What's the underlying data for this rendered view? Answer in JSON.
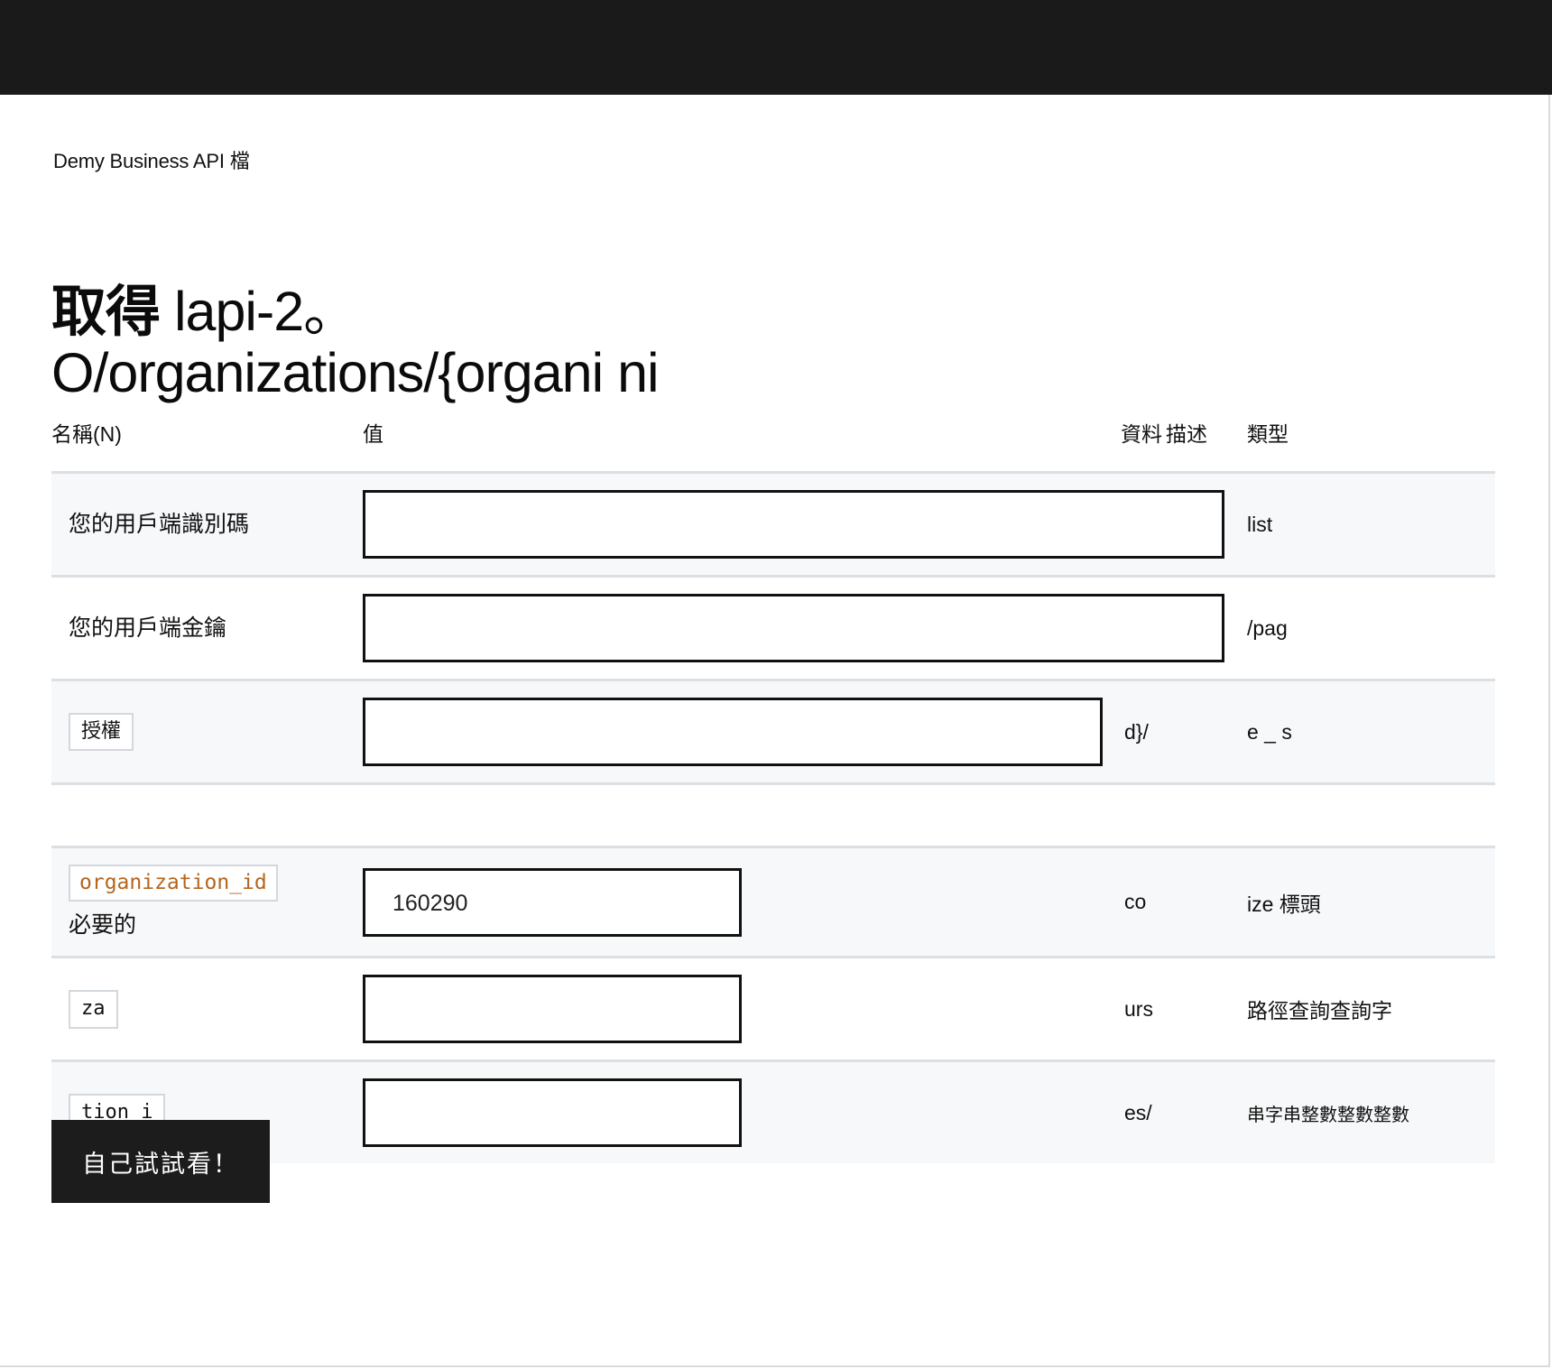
{
  "breadcrumb": "Demy Business API 檔",
  "title": {
    "verb": "取得",
    "path": "lapi-2。O/organizations/{organi ni"
  },
  "table": {
    "headers": {
      "name": "名稱(N)",
      "value": "值",
      "description": "描述",
      "data": "資料",
      "type": "類型"
    },
    "rows": [
      {
        "name_plain": "您的用戶端識別碼",
        "name_code": "",
        "required_label": "",
        "value": "",
        "data": "",
        "type": "list",
        "field_size": "long",
        "shaded": true
      },
      {
        "name_plain": "您的用戶端金鑰",
        "name_code": "",
        "required_label": "",
        "value": "",
        "data": "",
        "type": "/pag",
        "field_size": "long",
        "shaded": false
      },
      {
        "name_plain": "",
        "name_code": "授權",
        "required_label": "",
        "value": "",
        "data": "d}/",
        "type": "e _ s",
        "field_size": "mid",
        "shaded": true
      },
      {
        "name_plain": "",
        "name_code": "organization_id",
        "required_label": "必要的",
        "value": "160290",
        "data": "co",
        "type": "ize 標頭",
        "field_size": "short",
        "shaded": true
      },
      {
        "name_plain": "",
        "name_code": "za",
        "required_label": "",
        "value": "",
        "data": "urs",
        "type": "路徑查詢查詢字",
        "field_size": "short",
        "shaded": false
      },
      {
        "name_plain": "",
        "name_code": "tion_i",
        "required_label": "",
        "value": "",
        "data": "es/",
        "type": "串字串整數整數整數",
        "field_size": "short",
        "shaded": true
      }
    ]
  },
  "try_button": {
    "label": "自己試試看！"
  },
  "colors": {
    "topbar": "#1a1a1a",
    "code_orange": "#b5651d",
    "row_shade": "#f7f8fa",
    "row_divider": "#dcdfe3",
    "button_bg": "#1c1c1c"
  }
}
